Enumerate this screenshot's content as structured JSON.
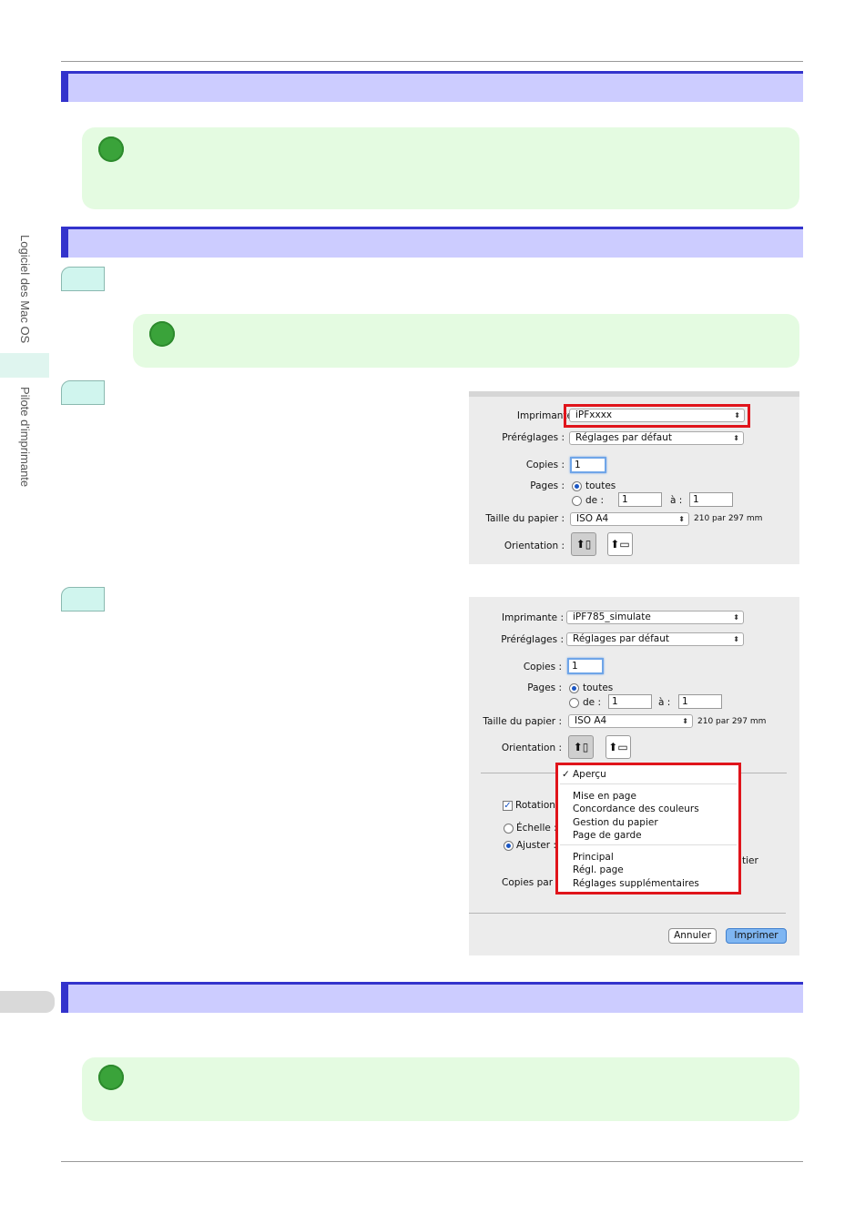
{
  "sidebar": {
    "section1": "Logiciel des Mac OS",
    "section2": "Pilote d'imprimante"
  },
  "dialog1": {
    "printer_label": "Imprimante",
    "printer_value": "iPFxxxx",
    "presets_label": "Préréglages :",
    "presets_value": "Réglages par défaut",
    "copies_label": "Copies :",
    "copies_value": "1",
    "pages_label": "Pages :",
    "pages_all": "toutes",
    "pages_from": "de :",
    "pages_from_value": "1",
    "pages_to": "à :",
    "pages_to_value": "1",
    "paper_label": "Taille du papier :",
    "paper_value": "ISO A4",
    "paper_dims": "210 par 297 mm",
    "orientation_label": "Orientation :"
  },
  "dialog2": {
    "printer_label": "Imprimante :",
    "printer_value": "iPF785_simulate",
    "presets_label": "Préréglages :",
    "presets_value": "Réglages par défaut",
    "copies_label": "Copies :",
    "copies_value": "1",
    "pages_label": "Pages :",
    "pages_all": "toutes",
    "pages_from": "de :",
    "pages_from_value": "1",
    "pages_to": "à :",
    "pages_to_value": "1",
    "paper_label": "Taille du papier :",
    "paper_value": "ISO A4",
    "paper_dims": "210 par 297 mm",
    "orientation_label": "Orientation :",
    "rotation_label": "Rotation",
    "scale_label": "Échelle :",
    "fit_label": "Ajuster :",
    "copies_per_label": "Copies par",
    "partial_tier": "tier",
    "menu_items": {
      "preview": "Aperçu",
      "layout": "Mise en page",
      "color_matching": "Concordance des couleurs",
      "paper_handling": "Gestion du papier",
      "cover_page": "Page de garde",
      "main": "Principal",
      "page_setup": "Régl. page",
      "additional": "Réglages supplémentaires"
    },
    "cancel_button": "Annuler",
    "print_button": "Imprimer"
  }
}
